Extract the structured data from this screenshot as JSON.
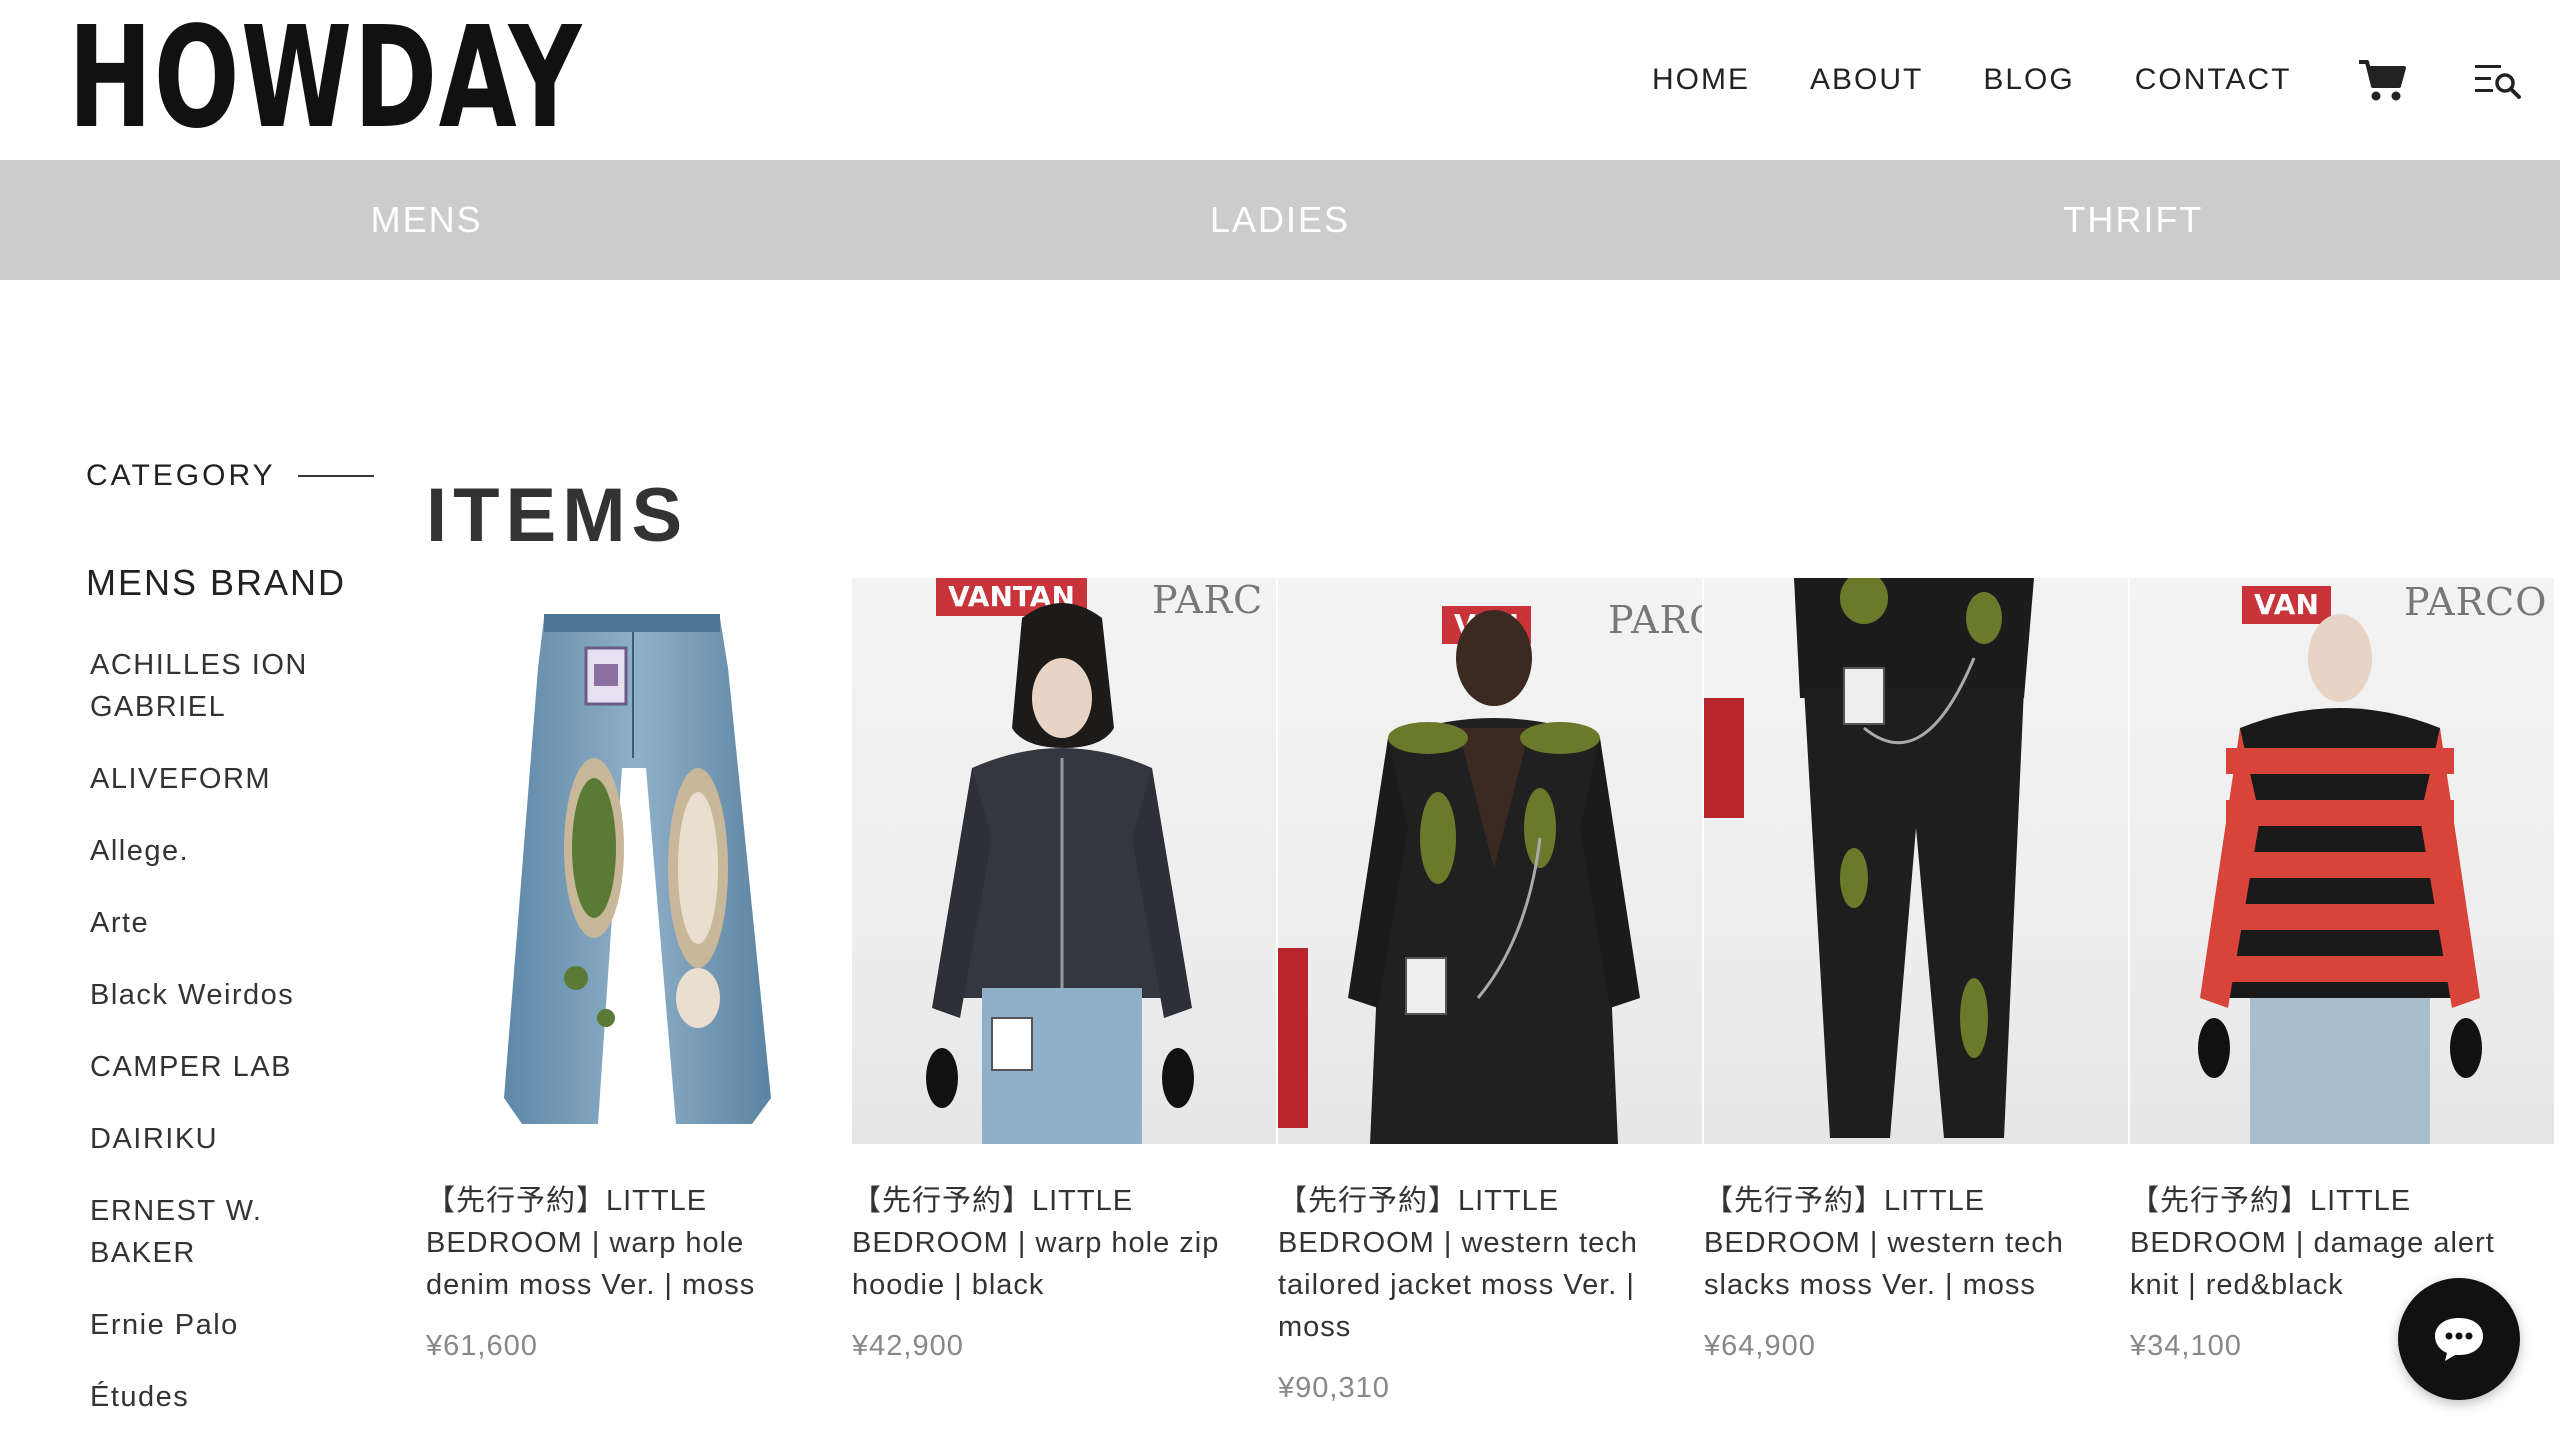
{
  "header": {
    "logo": "HOWDAY",
    "nav": [
      {
        "label": "HOME"
      },
      {
        "label": "ABOUT"
      },
      {
        "label": "BLOG"
      },
      {
        "label": "CONTACT"
      }
    ],
    "cart_icon": "cart-icon",
    "search_menu_icon": "menu-search-icon"
  },
  "category_bar": {
    "items": [
      {
        "label": "MENS"
      },
      {
        "label": "LADIES"
      },
      {
        "label": "THRIFT"
      }
    ],
    "bg_color": "#cccccc"
  },
  "sidebar": {
    "category_label": "CATEGORY",
    "brand_heading": "MENS BRAND",
    "brands": [
      "ACHILLES ION GABRIEL",
      "ALIVEFORM",
      "Allege.",
      "Arte",
      "Black Weirdos",
      "CAMPER LAB",
      "DAIRIKU",
      "ERNEST W. BAKER",
      "Ernie Palo",
      "Études"
    ]
  },
  "main": {
    "title": "ITEMS",
    "products": [
      {
        "name": "【先行予約】LITTLE BEDROOM | warp hole denim moss Ver. | moss",
        "price": "¥61,600"
      },
      {
        "name": "【先行予約】LITTLE BEDROOM | warp hole zip hoodie | black",
        "price": "¥42,900",
        "sponsor": "VANTAN",
        "mall": "PARC"
      },
      {
        "name": "【先行予約】LITTLE BEDROOM | western tech tailored jacket moss Ver. | moss",
        "price": "¥90,310",
        "sponsor": "VAN",
        "mall": "PARC"
      },
      {
        "name": "【先行予約】LITTLE BEDROOM | western tech slacks moss Ver. | moss",
        "price": "¥64,900"
      },
      {
        "name": "【先行予約】LITTLE BEDROOM | damage alert knit | red&black",
        "price": "¥34,100",
        "sponsor": "VAN",
        "mall": "PARCO"
      }
    ]
  },
  "chat": {
    "icon": "chat-bubble-icon"
  }
}
